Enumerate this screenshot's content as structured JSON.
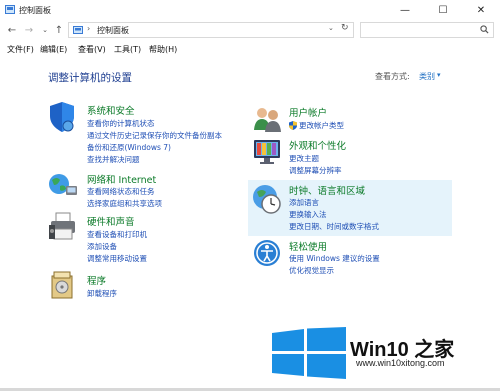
{
  "window": {
    "title": "控制面板",
    "minimize_glyph": "—",
    "maximize_glyph": "☐",
    "close_glyph": "✕"
  },
  "nav": {
    "back_glyph": "←",
    "forward_glyph": "→",
    "dropdown_glyph": "⌄",
    "up_glyph": "↑",
    "separator": "›",
    "path": "控制面板",
    "addr_dropdown_glyph": "⌄",
    "refresh_glyph": "↻",
    "search_placeholder": ""
  },
  "menu": [
    {
      "label": "文件(F)"
    },
    {
      "label": "编辑(E)"
    },
    {
      "label": "查看(V)"
    },
    {
      "label": "工具(T)"
    },
    {
      "label": "帮助(H)"
    }
  ],
  "heading": "调整计算机的设置",
  "view_by": {
    "label": "查看方式:",
    "value": "类别",
    "caret": "▾"
  },
  "categories_left": [
    {
      "title": "系统和安全",
      "icon": "shield-icon",
      "links": [
        "查看你的计算机状态",
        "通过文件历史记录保存你的文件备份副本",
        "备份和还原(Windows 7)",
        "查找并解决问题"
      ]
    },
    {
      "title": "网络和 Internet",
      "icon": "network-globe-icon",
      "links": [
        "查看网络状态和任务",
        "选择家庭组和共享选项"
      ]
    },
    {
      "title": "硬件和声音",
      "icon": "printer-icon",
      "links": [
        "查看设备和打印机",
        "添加设备",
        "调整常用移动设置"
      ]
    },
    {
      "title": "程序",
      "icon": "programs-icon",
      "links": [
        "卸载程序"
      ]
    }
  ],
  "categories_right": [
    {
      "title": "用户帐户",
      "icon": "users-icon",
      "links": [
        "更改帐户类型"
      ]
    },
    {
      "title": "外观和个性化",
      "icon": "monitor-palette-icon",
      "links": [
        "更改主题",
        "调整屏幕分辨率"
      ]
    },
    {
      "title": "时钟、语言和区域",
      "icon": "clock-globe-icon",
      "links": [
        "添加语言",
        "更换输入法",
        "更改日期、时间或数字格式"
      ]
    },
    {
      "title": "轻松使用",
      "icon": "ease-of-access-icon",
      "links": [
        "使用 Windows 建议的设置",
        "优化视觉显示"
      ]
    }
  ],
  "watermark": {
    "brand": "Win10 之家",
    "url": "www.win10xitong.com",
    "logo_color": "#1a8fe3"
  },
  "colors": {
    "category_title": "#0b7a28",
    "link": "#1f4fb5",
    "heading": "#1f3f91"
  }
}
